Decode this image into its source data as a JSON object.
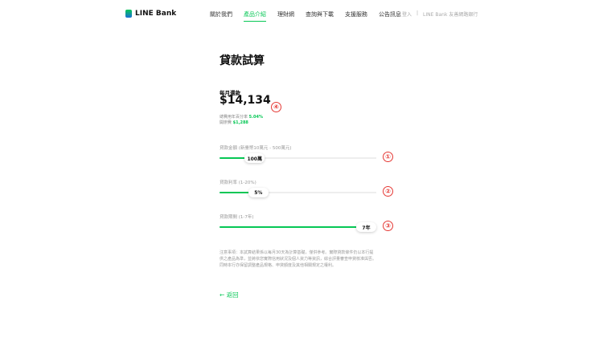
{
  "header": {
    "logo": "LINE Bank",
    "nav": [
      "關於我們",
      "產品介紹",
      "理財網",
      "查詢與下載",
      "支援服務",
      "公告訊息"
    ],
    "active_index": 1,
    "login": "登入",
    "separator": "|",
    "util_link": "LINE Bank 友善網路銀行"
  },
  "page": {
    "title": "貸款試算",
    "monthly_label": "每月還款",
    "monthly_amount": "$14,134",
    "apr_label": "總費用年百分率",
    "apr_value": "5.04%",
    "fee_label": "開辦費",
    "fee_value": "$1,288"
  },
  "sliders": [
    {
      "label": "貸款金額 (新臺幣10萬元 - 500萬元)",
      "value": 100,
      "min": 10,
      "max": 500,
      "display": "100萬",
      "annotation": "①"
    },
    {
      "label": "貸款利率 (1-20%)",
      "value": 5,
      "min": 1,
      "max": 20,
      "display": "5%",
      "annotation": "②"
    },
    {
      "label": "貸款期間 (1-7年)",
      "value": 7,
      "min": 1,
      "max": 7,
      "display": "7年",
      "annotation": "③"
    }
  ],
  "amount_annotation": "④",
  "note": "注意事項：本試算結果係以每月30天為計算基礎，僅供參考。實際貸款條件仍以本行提供之產品為準，並將依您實際信用狀況及個人資力等資訊，綜合評量審查申貸核准與否。同時本行亦保留調整產品規格、申貸額度及其他相關規定之權利。",
  "back_label": "← 返回",
  "colors": {
    "accent": "#06c755",
    "annotation": "#e53935"
  }
}
